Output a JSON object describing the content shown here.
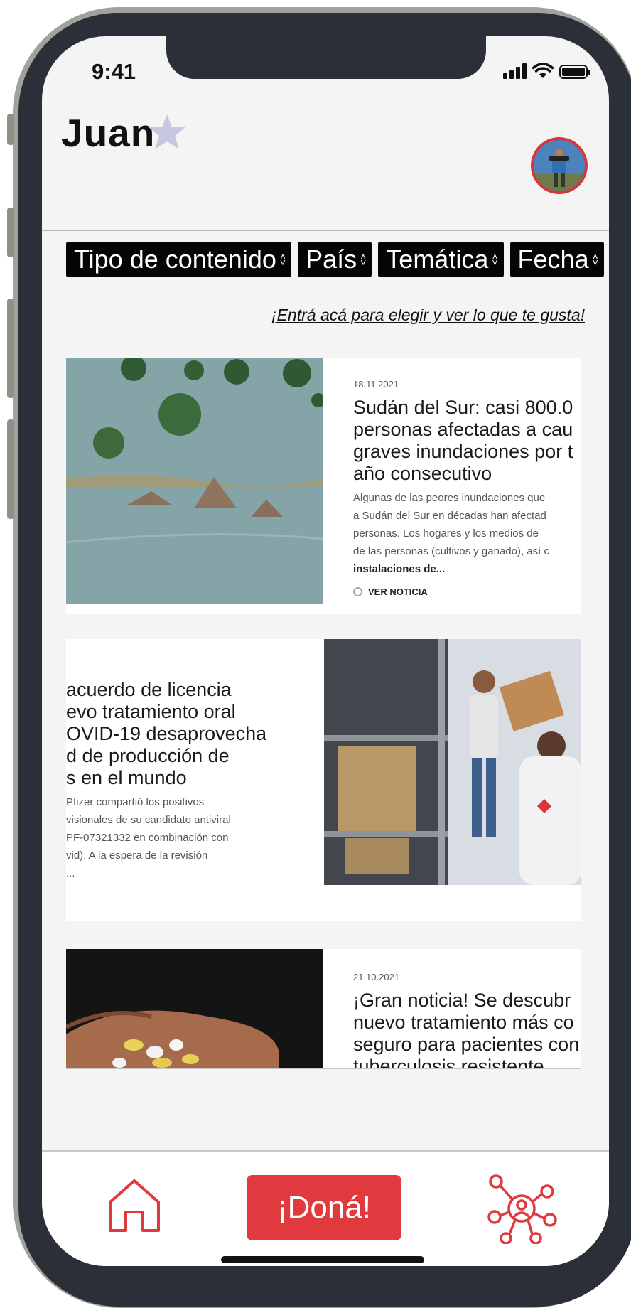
{
  "status": {
    "time": "9:41"
  },
  "header": {
    "name": "Juan"
  },
  "filters": [
    {
      "label": "Tipo de contenido"
    },
    {
      "label": "País"
    },
    {
      "label": "Temática"
    },
    {
      "label": "Fecha"
    }
  ],
  "hint": "¡Entrá acá para elegir y ver lo que te gusta!",
  "articles": [
    {
      "date": "18.11.2021",
      "headline": [
        "Sudán del Sur: casi 800.0",
        "personas afectadas a cau",
        "graves inundaciones por t",
        "año consecutivo"
      ],
      "excerpt": [
        "Algunas de las peores inundaciones que",
        "a Sudán del Sur en décadas han afectad",
        "personas. Los hogares y los medios de",
        "de las personas (cultivos y ganado), así c",
        "instalaciones de..."
      ],
      "cta": "VER NOTICIA"
    },
    {
      "headline": [
        "acuerdo de licencia",
        "evo tratamiento oral",
        "OVID-19 desaprovecha",
        "d de producción de",
        "s en el mundo"
      ],
      "excerpt": [
        "Pfizer compartió los positivos",
        "visionales de su candidato antiviral",
        "PF-07321332 en combinación con",
        "vid). A la espera de la revisión",
        "..."
      ]
    },
    {
      "date": "21.10.2021",
      "headline": [
        "¡Gran noticia! Se descubr",
        "nuevo tratamiento más co",
        "seguro para pacientes con",
        "tuberculosis resistente"
      ]
    }
  ],
  "tabbar": {
    "donate_label": "¡Doná!"
  },
  "colors": {
    "accent": "#e0393e",
    "filter_bg": "#050505",
    "screen_bg": "#f4f4f4"
  }
}
